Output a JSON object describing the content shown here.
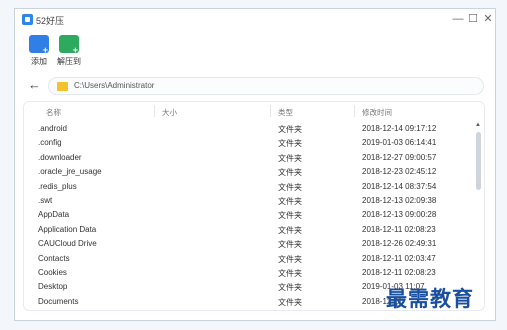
{
  "window": {
    "title": "52好压",
    "minimize": "—",
    "maximize": "☐",
    "close": "✕"
  },
  "toolbar": {
    "add_label": "添加",
    "extract_label": "解压到"
  },
  "path": "C:\\Users\\Administrator",
  "columns": {
    "name": "名称",
    "size": "大小",
    "type": "类型",
    "modified": "修改时间"
  },
  "files": [
    {
      "name": ".android",
      "size": "",
      "type": "文件夹",
      "modified": "2018-12-14 09:17:12"
    },
    {
      "name": ".config",
      "size": "",
      "type": "文件夹",
      "modified": "2019-01-03 06:14:41"
    },
    {
      "name": ".downloader",
      "size": "",
      "type": "文件夹",
      "modified": "2018-12-27 09:00:57"
    },
    {
      "name": ".oracle_jre_usage",
      "size": "",
      "type": "文件夹",
      "modified": "2018-12-23 02:45:12"
    },
    {
      "name": ".redis_plus",
      "size": "",
      "type": "文件夹",
      "modified": "2018-12-14 08:37:54"
    },
    {
      "name": ".swt",
      "size": "",
      "type": "文件夹",
      "modified": "2018-12-13 02:09:38"
    },
    {
      "name": "AppData",
      "size": "",
      "type": "文件夹",
      "modified": "2018-12-13 09:00:28"
    },
    {
      "name": "Application Data",
      "size": "",
      "type": "文件夹",
      "modified": "2018-12-11 02:08:23"
    },
    {
      "name": "CAUCloud Drive",
      "size": "",
      "type": "文件夹",
      "modified": "2018-12-26 02:49:31"
    },
    {
      "name": "Contacts",
      "size": "",
      "type": "文件夹",
      "modified": "2018-12-11 02:03:47"
    },
    {
      "name": "Cookies",
      "size": "",
      "type": "文件夹",
      "modified": "2018-12-11 02:08:23"
    },
    {
      "name": "Desktop",
      "size": "",
      "type": "文件夹",
      "modified": "2019-01-03 11:07"
    },
    {
      "name": "Documents",
      "size": "",
      "type": "文件夹",
      "modified": "2018-12-11"
    }
  ],
  "watermark": "最需教育",
  "icons": {
    "app": "app-logo-icon",
    "add": "add-icon",
    "extract": "extract-icon",
    "back": "back-arrow-icon",
    "folder": "folder-icon",
    "scroll_up": "scroll-up-arrow-icon"
  },
  "colors": {
    "add_icon": "#2f7fe6",
    "extract_icon": "#2eaa5e",
    "folder": "#f5c22f",
    "watermark": "#1a4fa0"
  }
}
